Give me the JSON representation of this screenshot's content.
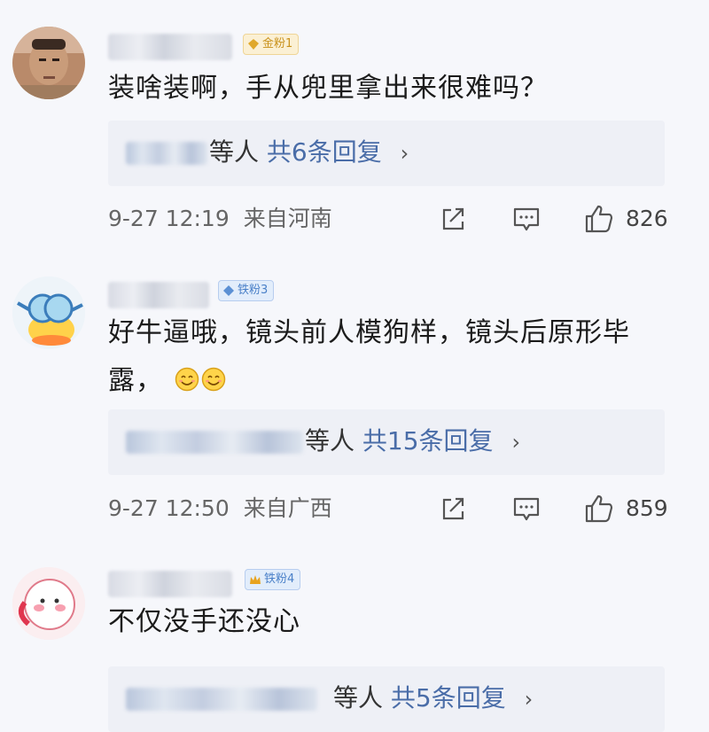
{
  "comments": [
    {
      "badge_label": "金粉1",
      "text_line1": "装啥装啊，手从兜里拿出来很难吗？",
      "text_line2": "",
      "reply_suffix": "等人",
      "reply_count": "共6条回复",
      "time": "9-27 12:19",
      "location": "来自河南",
      "likes": "826",
      "badge_color": "#d4a017"
    },
    {
      "badge_label": "铁粉3",
      "text_line1": "好牛逼哦，镜头前人模狗样，镜头后原形毕",
      "text_line2": "露，",
      "reply_suffix": "等人",
      "reply_count": "共15条回复",
      "time": "9-27 12:50",
      "location": "来自广西",
      "likes": "859",
      "badge_color": "#4a80c8"
    },
    {
      "badge_label": "铁粉4",
      "text_line1": "不仅没手还没心",
      "text_line2": "",
      "reply_suffix": "等人",
      "reply_count": "共5条回复",
      "badge_color": "#4a80c8"
    }
  ],
  "icons": {
    "reply_chevron": "›",
    "share": "share-icon",
    "comment": "comment-icon",
    "like": "like-icon"
  }
}
